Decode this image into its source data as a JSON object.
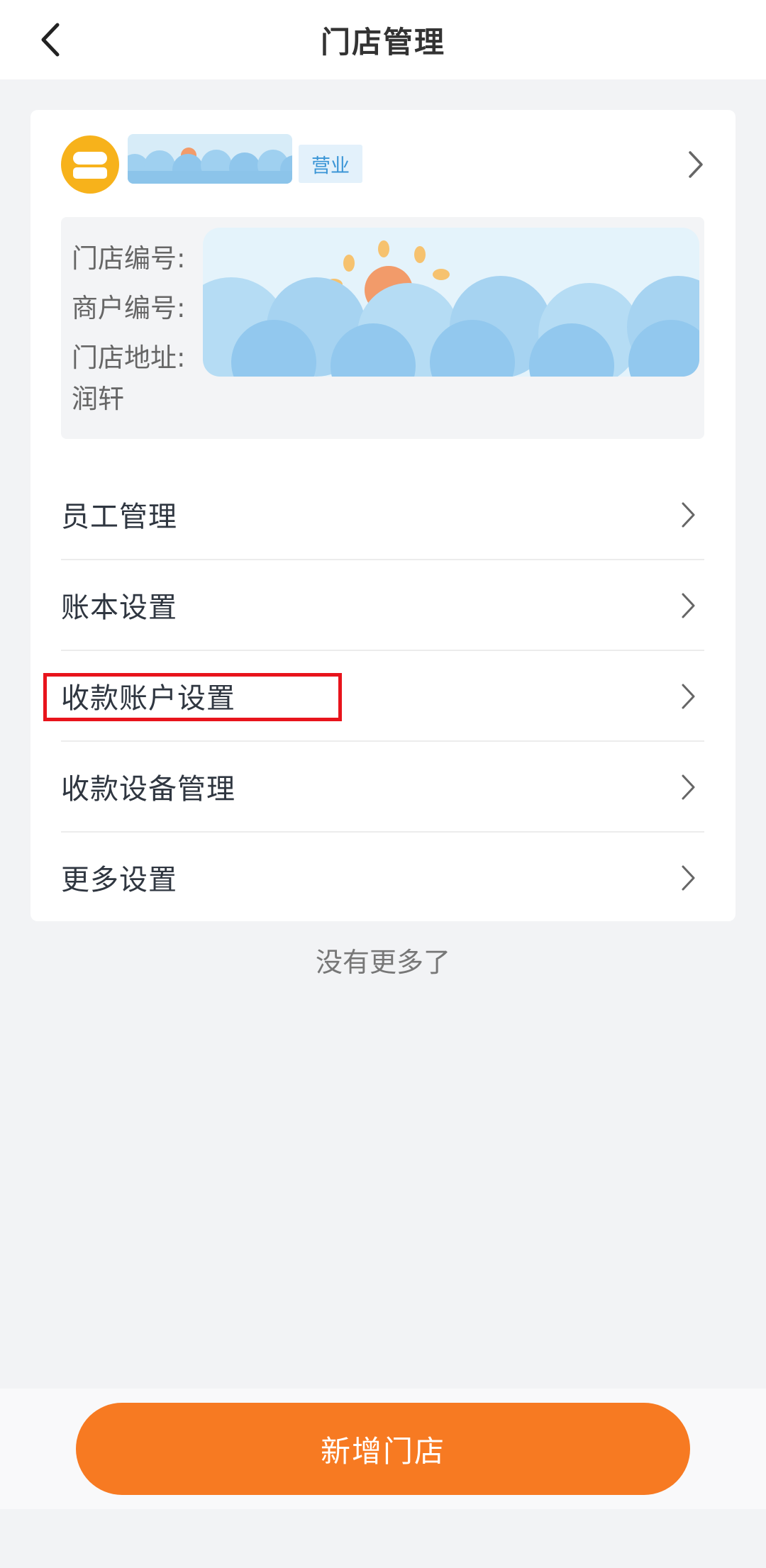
{
  "header": {
    "title": "门店管理",
    "back_icon": "chevron-left-icon"
  },
  "store": {
    "status": "营业",
    "info": {
      "store_no_label": "门店编号:",
      "merchant_no_label": "商户编号:",
      "address_label": "门店地址:",
      "address_tail": "润轩"
    }
  },
  "menu": [
    {
      "label": "员工管理"
    },
    {
      "label": "账本设置"
    },
    {
      "label": "收款账户设置"
    },
    {
      "label": "收款设备管理"
    },
    {
      "label": "更多设置"
    }
  ],
  "list_end_text": "没有更多了",
  "footer": {
    "add_store_label": "新增门店"
  },
  "colors": {
    "accent": "#f77a22",
    "status_badge_bg": "#e3f1fb",
    "status_badge_text": "#3a95d6",
    "highlight": "#e8141c",
    "logo": "#f7b21b"
  }
}
